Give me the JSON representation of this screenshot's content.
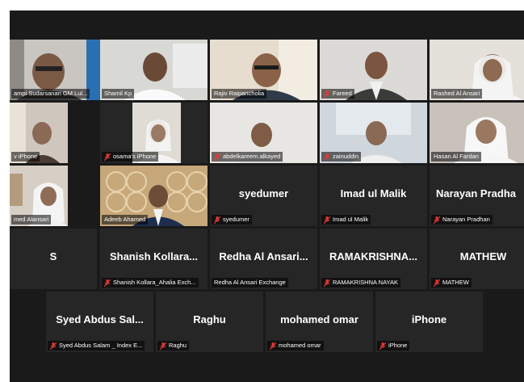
{
  "colors": {
    "active_speaker": "#e5e37a",
    "muted": "#e53935",
    "background": "#1a1a1a",
    "tile": "#262626"
  },
  "participants": [
    {
      "label": "ampi Sudarsanan GM Lul...",
      "muted": false
    },
    {
      "label": "Shamil Kp",
      "muted": false
    },
    {
      "label": "Rajiv Raipancholia",
      "muted": false
    },
    {
      "label": "Fareed",
      "muted": true
    },
    {
      "label": "Rashed Al Ansari",
      "muted": false
    },
    {
      "label": "v iPhone",
      "muted": false
    },
    {
      "label": "osama's iPhone",
      "muted": true
    },
    {
      "label": "abdelkareem.alkayed",
      "muted": true
    },
    {
      "label": "zainuddin",
      "muted": true
    },
    {
      "label": "Hasan Al Fardan",
      "muted": false
    },
    {
      "label": "med Alansari",
      "muted": false
    },
    {
      "label": "Adeeb Ahamed",
      "muted": false
    },
    {
      "name": "syedumer",
      "label": "syedumer",
      "muted": true
    },
    {
      "name": "Imad ul Malik",
      "label": "Imad ul Malik",
      "muted": true
    },
    {
      "name": "Narayan Pradha",
      "label": "Narayan Pradhan",
      "muted": true
    },
    {
      "name": "S",
      "label": "",
      "muted": false
    },
    {
      "name": "Shanish Kollara...",
      "label": "Shanish Kollara_Ahalia Exch...",
      "muted": true
    },
    {
      "name": "Redha Al Ansari...",
      "label": "Redha Al Ansari Exchange",
      "muted": false
    },
    {
      "name": "RAMAKRISHNA...",
      "label": "RAMAKRISHNA NAYAK",
      "muted": true
    },
    {
      "name": "MATHEW",
      "label": "MATHEW",
      "muted": true
    },
    {
      "name": "Syed Abdus Sal...",
      "label": "Syed Abdus Salam _ Index E...",
      "muted": true
    },
    {
      "name": "Raghu",
      "label": "Raghu",
      "muted": true
    },
    {
      "name": "mohamed omar",
      "label": "mohamed omar",
      "muted": true
    },
    {
      "name": "iPhone",
      "label": "iPhone",
      "muted": true
    }
  ]
}
